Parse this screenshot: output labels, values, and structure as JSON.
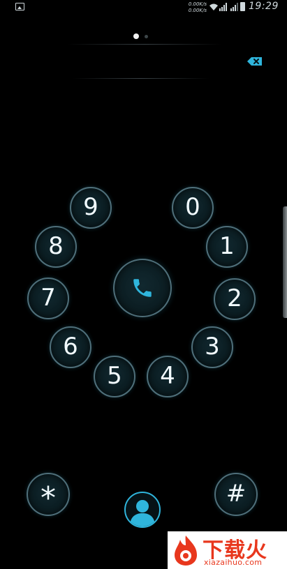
{
  "status_bar": {
    "icon": "image-icon",
    "net_speed_up": "0.00K/s",
    "net_speed_down": "0.00K/s",
    "time": "19:29"
  },
  "pager": {
    "active_page": 1,
    "page_count": 2
  },
  "dialer": {
    "number": "",
    "keys": {
      "k9": "9",
      "k0": "0",
      "k8": "8",
      "k1": "1",
      "k7": "7",
      "k2": "2",
      "k6": "6",
      "k3": "3",
      "k5": "5",
      "k4": "4",
      "star": "*",
      "hash": "#"
    },
    "call_icon": "phone-icon",
    "backspace_icon": "backspace-icon",
    "contacts_icon": "person-icon"
  },
  "colors": {
    "accent": "#2fb5dc",
    "key_border": "#4f6f7a",
    "background": "#000000"
  },
  "watermark": {
    "text": "下载火",
    "url": "xiazaihuo.com"
  }
}
